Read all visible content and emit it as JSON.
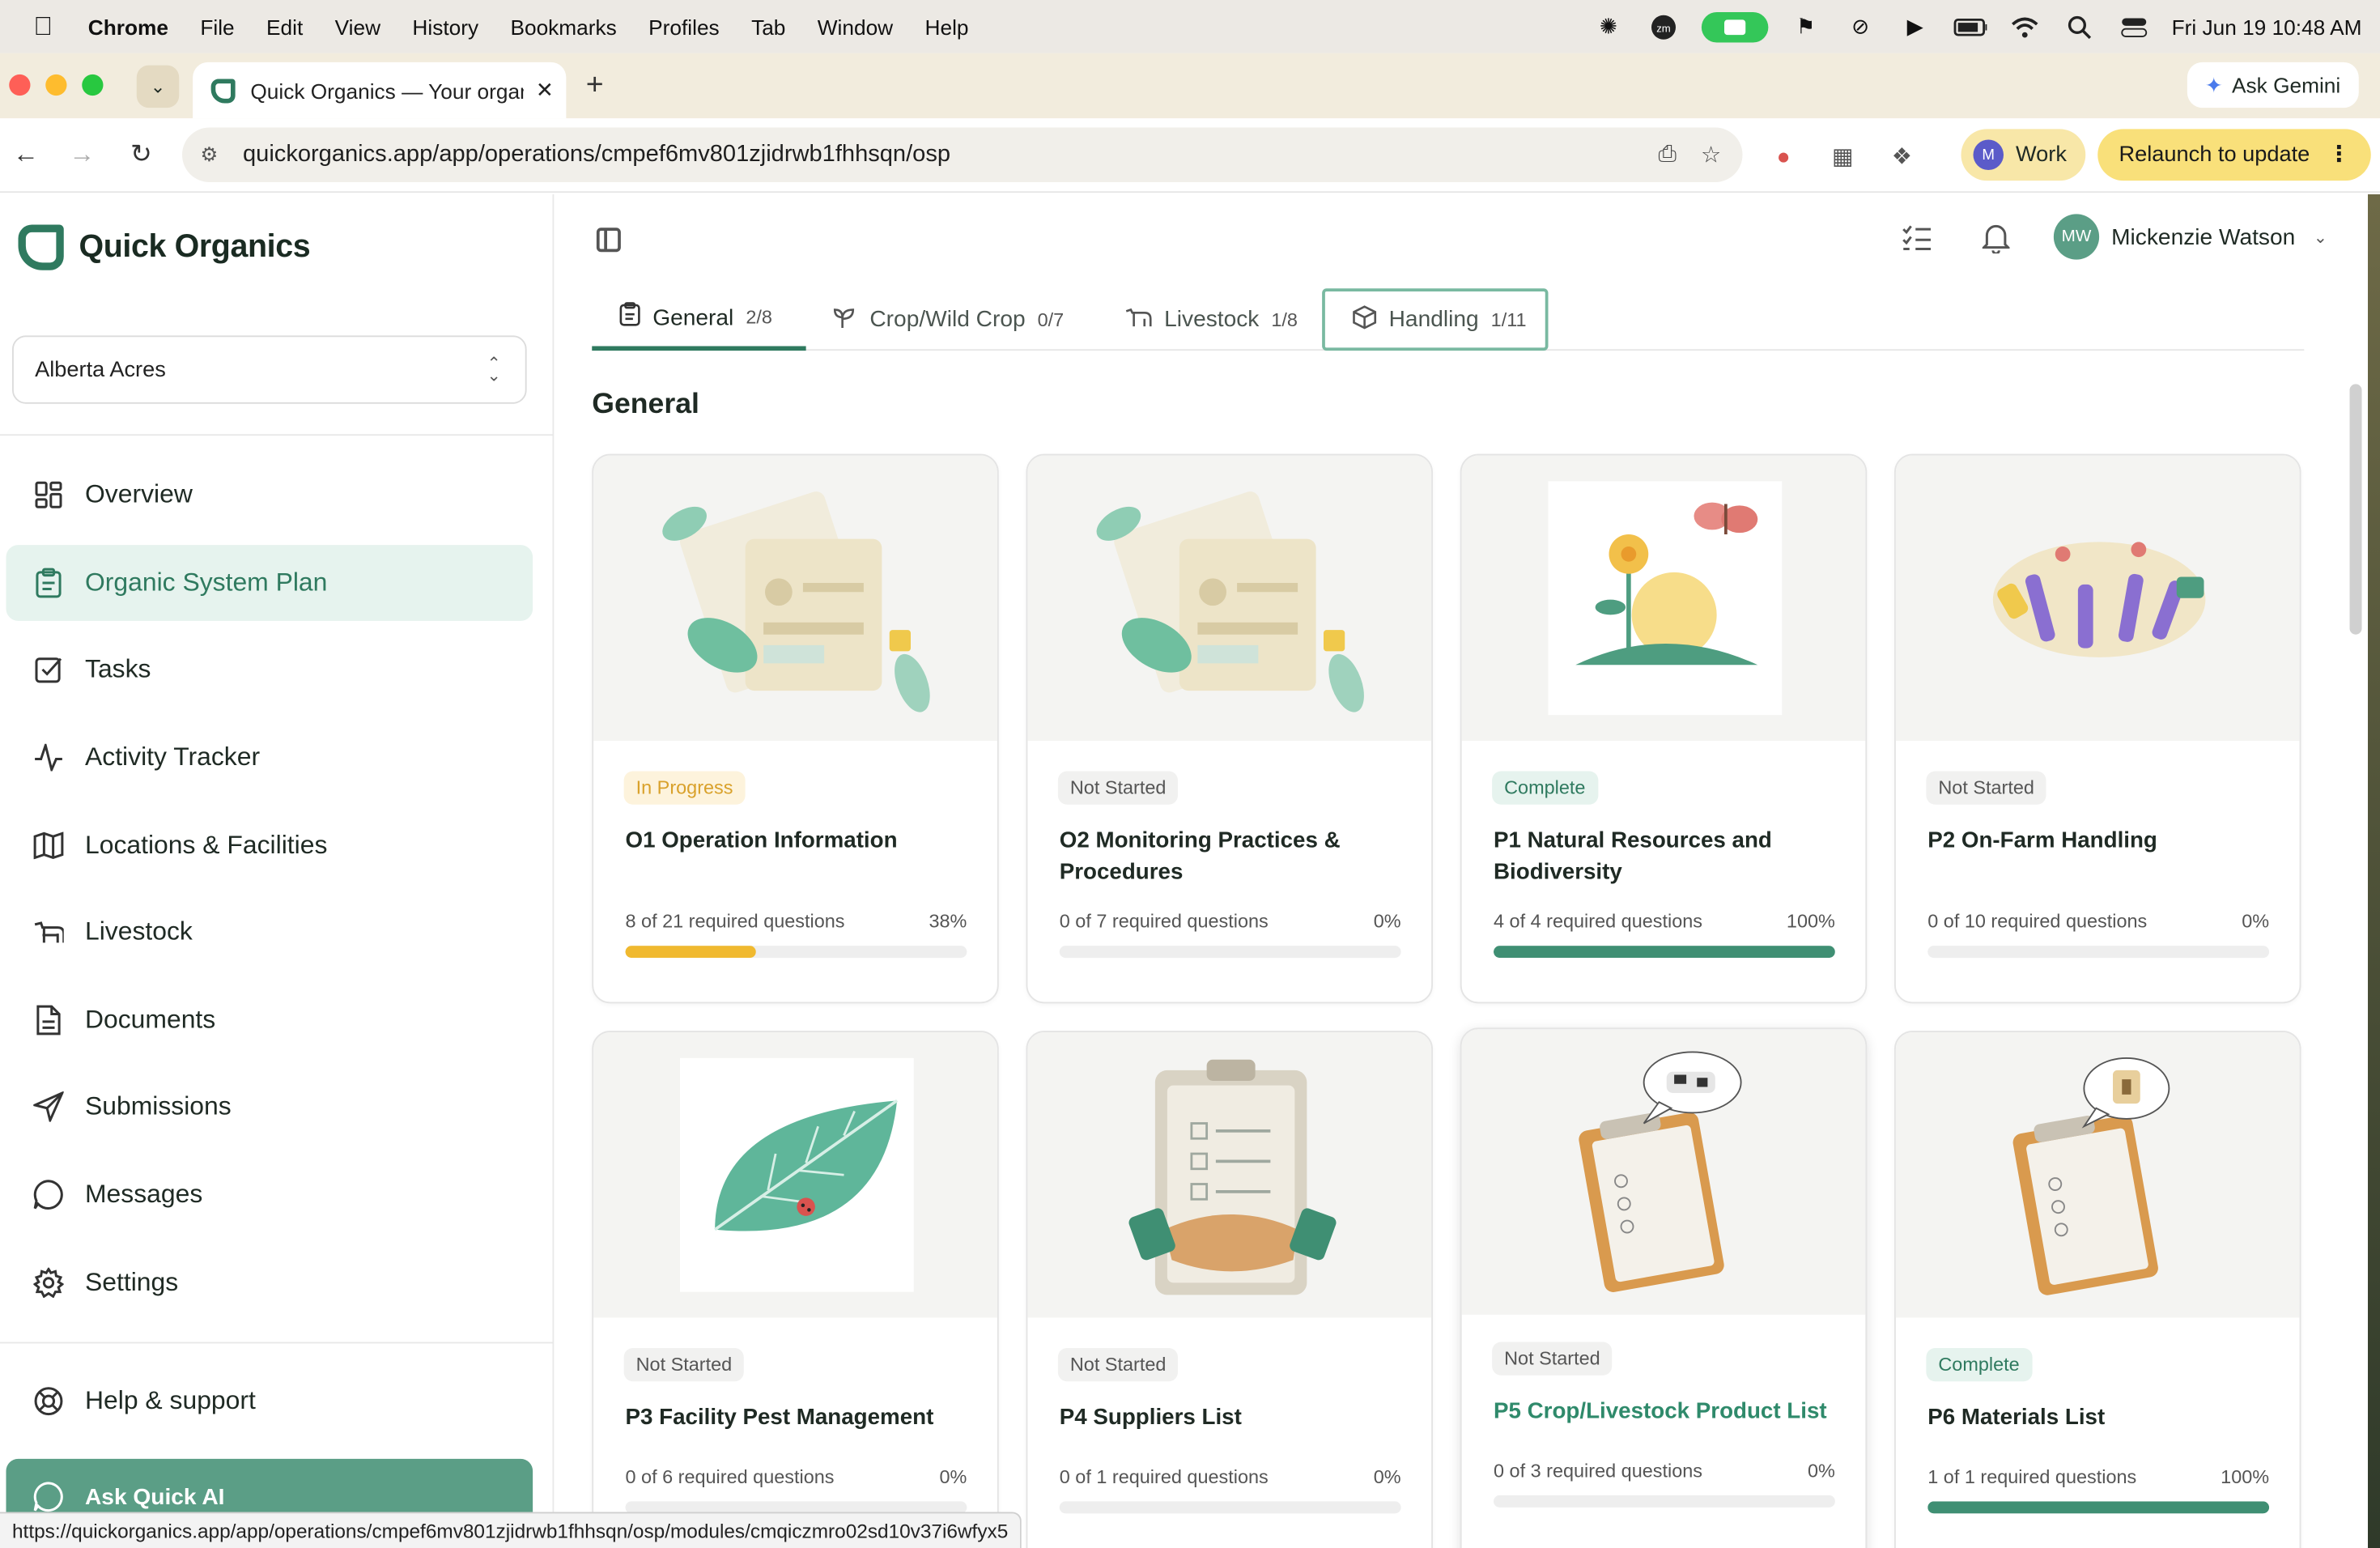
{
  "menubar": {
    "app": "Chrome",
    "items": [
      "File",
      "Edit",
      "View",
      "History",
      "Bookmarks",
      "Profiles",
      "Tab",
      "Window",
      "Help"
    ],
    "clock": "Fri Jun 19  10:48 AM"
  },
  "browser": {
    "tab_title": "Quick Organics — Your organi",
    "ask_gemini": "Ask Gemini",
    "url": "quickorganics.app/app/operations/cmpef6mv801zjidrwb1fhhsqn/osp",
    "profile_initial": "M",
    "profile_label": "Work",
    "relaunch_label": "Relaunch to update",
    "status_url": "https://quickorganics.app/app/operations/cmpef6mv801zjidrwb1fhhsqn/osp/modules/cmqiczmro02sd10v37i6wfyx5"
  },
  "sidebar": {
    "brand": "Quick Organics",
    "operation": "Alberta Acres",
    "items": [
      {
        "label": "Overview",
        "icon": "dashboard-icon"
      },
      {
        "label": "Organic System Plan",
        "icon": "clipboard-icon"
      },
      {
        "label": "Tasks",
        "icon": "checkbox-icon"
      },
      {
        "label": "Activity Tracker",
        "icon": "activity-icon"
      },
      {
        "label": "Locations & Facilities",
        "icon": "map-icon"
      },
      {
        "label": "Livestock",
        "icon": "cow-icon"
      },
      {
        "label": "Documents",
        "icon": "document-icon"
      },
      {
        "label": "Submissions",
        "icon": "send-icon"
      },
      {
        "label": "Messages",
        "icon": "message-icon"
      },
      {
        "label": "Settings",
        "icon": "gear-icon"
      }
    ],
    "help": "Help & support",
    "ask_ai": "Ask Quick AI"
  },
  "header": {
    "user_initials": "MW",
    "user_name": "Mickenzie Watson"
  },
  "tabs": [
    {
      "label": "General",
      "count": "2/8"
    },
    {
      "label": "Crop/Wild Crop",
      "count": "0/7"
    },
    {
      "label": "Livestock",
      "count": "1/8"
    },
    {
      "label": "Handling",
      "count": "1/11"
    }
  ],
  "section_title": "General",
  "colors": {
    "brand": "#2f7a5f",
    "in_progress": "#f0b92f",
    "complete": "#3f8f73"
  },
  "cards": [
    {
      "status": "In Progress",
      "title": "O1 Operation Information",
      "req": "8 of 21 required questions",
      "pct": "38%",
      "progress": 0.38
    },
    {
      "status": "Not Started",
      "title": "O2 Monitoring Practices & Procedures",
      "req": "0 of 7 required questions",
      "pct": "0%",
      "progress": 0
    },
    {
      "status": "Complete",
      "title": "P1 Natural Resources and Biodiversity",
      "req": "4 of 4 required questions",
      "pct": "100%",
      "progress": 1
    },
    {
      "status": "Not Started",
      "title": "P2 On-Farm Handling",
      "req": "0 of 10 required questions",
      "pct": "0%",
      "progress": 0
    },
    {
      "status": "Not Started",
      "title": "P3 Facility Pest Management",
      "req": "0 of 6 required questions",
      "pct": "0%",
      "progress": 0
    },
    {
      "status": "Not Started",
      "title": "P4 Suppliers List",
      "req": "0 of 1 required questions",
      "pct": "0%",
      "progress": 0
    },
    {
      "status": "Not Started",
      "title": "P5 Crop/Livestock Product List",
      "req": "0 of 3 required questions",
      "pct": "0%",
      "progress": 0
    },
    {
      "status": "Complete",
      "title": "P6 Materials List",
      "req": "1 of 1 required questions",
      "pct": "100%",
      "progress": 1
    }
  ]
}
